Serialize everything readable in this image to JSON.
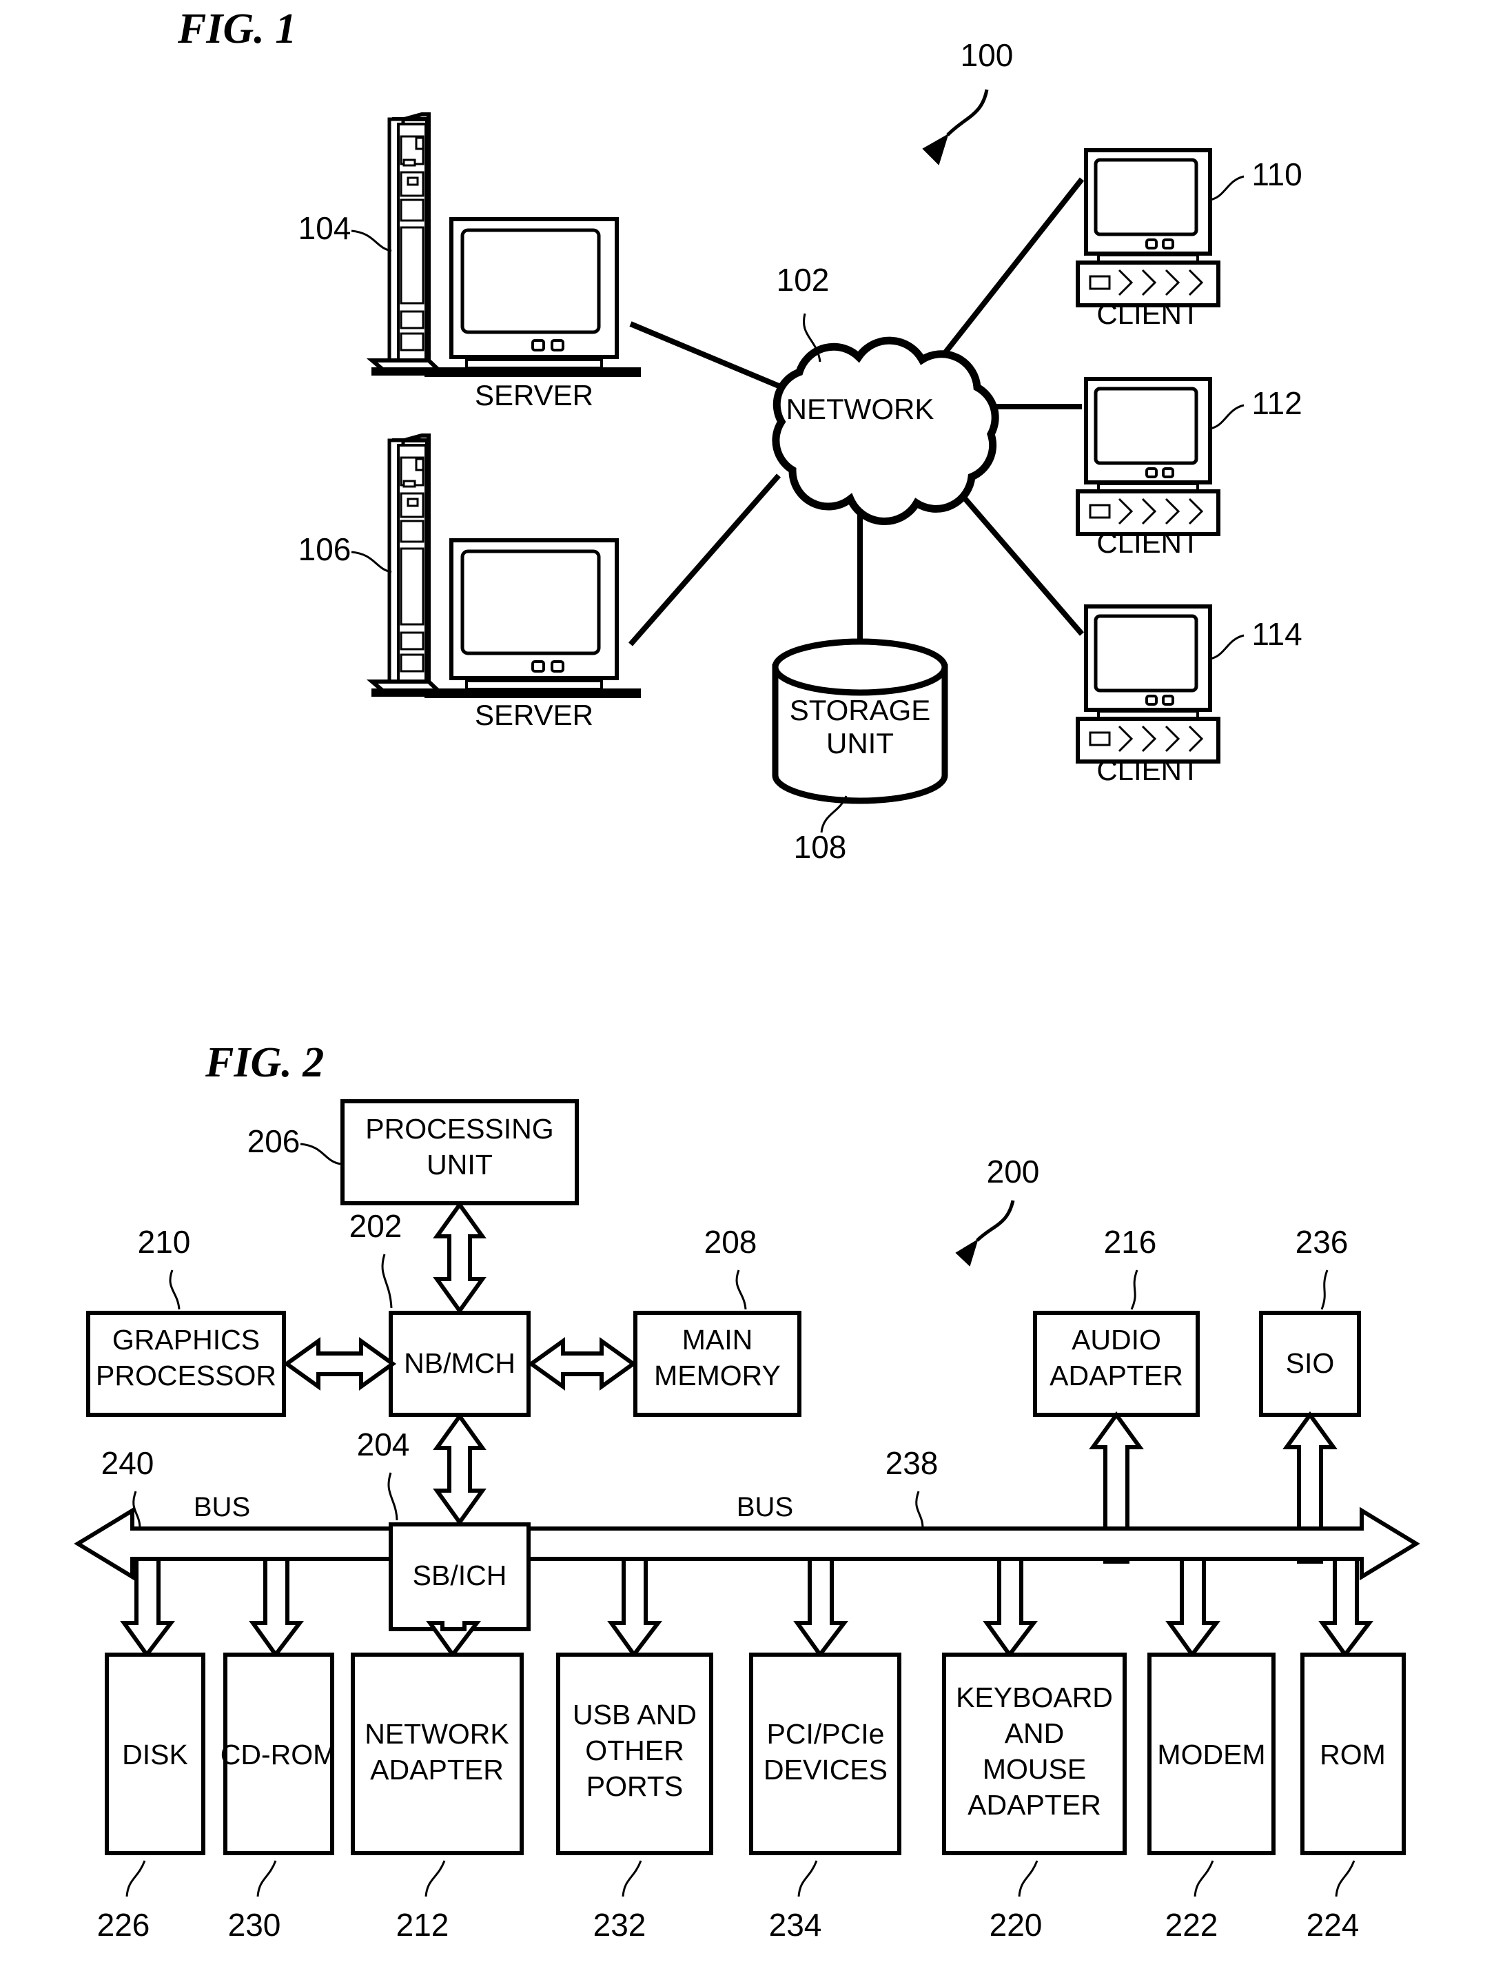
{
  "document": {
    "type": "patent-figure-sheet",
    "figures": [
      "FIG. 1",
      "FIG. 2"
    ]
  },
  "fig1": {
    "title": "FIG. 1",
    "system_ref": "100",
    "nodes": {
      "server_top": {
        "label": "SERVER",
        "ref": "104"
      },
      "server_bottom": {
        "label": "SERVER",
        "ref": "106"
      },
      "network": {
        "label": "NETWORK",
        "ref": "102"
      },
      "storage": {
        "label_line1": "STORAGE",
        "label_line2": "UNIT",
        "ref": "108"
      },
      "client_1": {
        "label": "CLIENT",
        "ref": "110"
      },
      "client_2": {
        "label": "CLIENT",
        "ref": "112"
      },
      "client_3": {
        "label": "CLIENT",
        "ref": "114"
      }
    }
  },
  "fig2": {
    "title": "FIG. 2",
    "system_ref": "200",
    "blocks": {
      "processing_unit": {
        "line1": "PROCESSING",
        "line2": "UNIT",
        "ref": "206"
      },
      "nb_mch": {
        "line1": "NB/MCH",
        "line2": "",
        "ref": "202"
      },
      "graphics_processor": {
        "line1": "GRAPHICS",
        "line2": "PROCESSOR",
        "ref": "210"
      },
      "main_memory": {
        "line1": "MAIN",
        "line2": "MEMORY",
        "ref": "208"
      },
      "audio_adapter": {
        "line1": "AUDIO",
        "line2": "ADAPTER",
        "ref": "216"
      },
      "sio": {
        "line1": "SIO",
        "line2": "",
        "ref": "236"
      },
      "sb_ich": {
        "line1": "SB/ICH",
        "line2": "",
        "ref": "204"
      }
    },
    "bus_left": {
      "label": "BUS",
      "ref": "240"
    },
    "bus_right": {
      "label": "BUS",
      "ref": "238"
    },
    "peripherals": [
      {
        "lines": [
          "DISK"
        ],
        "ref": "226"
      },
      {
        "lines": [
          "CD-ROM"
        ],
        "ref": "230"
      },
      {
        "lines": [
          "NETWORK",
          "ADAPTER"
        ],
        "ref": "212"
      },
      {
        "lines": [
          "USB AND",
          "OTHER",
          "PORTS"
        ],
        "ref": "232"
      },
      {
        "lines": [
          "PCI/PCIe",
          "DEVICES"
        ],
        "ref": "234"
      },
      {
        "lines": [
          "KEYBOARD",
          "AND",
          "MOUSE",
          "ADAPTER"
        ],
        "ref": "220"
      },
      {
        "lines": [
          "MODEM"
        ],
        "ref": "222"
      },
      {
        "lines": [
          "ROM"
        ],
        "ref": "224"
      }
    ]
  },
  "colors": {
    "ink": "#000000",
    "paper": "#ffffff"
  }
}
